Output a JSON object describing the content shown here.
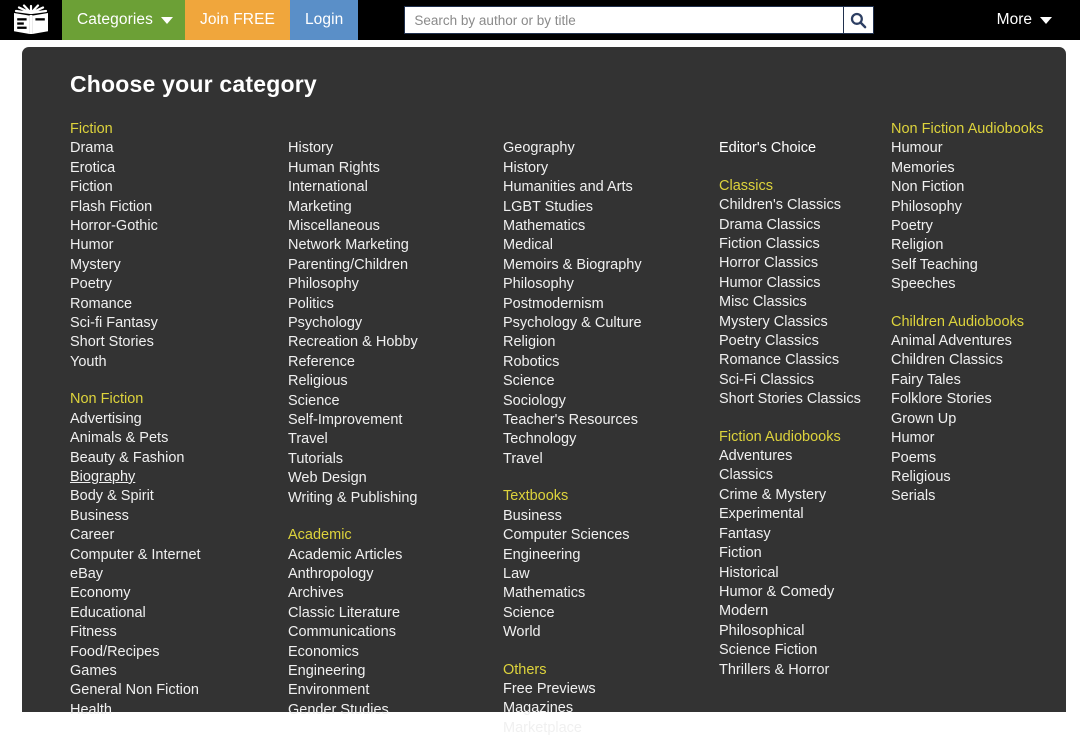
{
  "nav": {
    "logo_icon": "open-book-logo-icon",
    "categories_label": "Categories",
    "categories_caret_icon": "chevron-down-icon",
    "join_label": "Join FREE",
    "login_label": "Login",
    "more_label": "More",
    "more_caret_icon": "chevron-down-icon",
    "colors": {
      "bar": "#000000",
      "categories": "#6ca036",
      "join": "#f0a63c",
      "login": "#5a8fc8"
    }
  },
  "search": {
    "placeholder": "Search by author or by title",
    "value": "",
    "button_icon": "search-icon",
    "icon_color": "#2d3f63"
  },
  "panel": {
    "title": "Choose your category",
    "background": "#333333",
    "heading_color": "#ddd33c",
    "link_color": "#f0f0f0",
    "hovered_item": "Biography",
    "columns": [
      {
        "id": "column-1",
        "groups": [
          {
            "heading": "Fiction",
            "heading_style": "accent",
            "items": [
              "Drama",
              "Erotica",
              "Fiction",
              "Flash Fiction",
              "Horror-Gothic",
              "Humor",
              "Mystery",
              "Poetry",
              "Romance",
              "Sci-fi Fantasy",
              "Short Stories",
              "Youth"
            ]
          },
          {
            "heading": "Non Fiction",
            "heading_style": "accent",
            "items": [
              "Advertising",
              "Animals & Pets",
              "Beauty & Fashion",
              "Biography",
              "Body & Spirit",
              "Business",
              "Career",
              "Computer & Internet",
              "eBay",
              "Economy",
              "Educational",
              "Fitness",
              "Food/Recipes",
              "Games",
              "General Non Fiction",
              "Health"
            ]
          }
        ]
      },
      {
        "id": "column-2",
        "top_offset_rows": 1,
        "groups": [
          {
            "heading": null,
            "items": [
              "History",
              "Human Rights",
              "International",
              "Marketing",
              "Miscellaneous",
              "Network Marketing",
              "Parenting/Children",
              "Philosophy",
              "Politics",
              "Psychology",
              "Recreation & Hobby",
              "Reference",
              "Religious",
              "Science",
              "Self-Improvement",
              "Travel",
              "Tutorials",
              "Web Design",
              "Writing & Publishing"
            ]
          },
          {
            "heading": "Academic",
            "heading_style": "accent",
            "items": [
              "Academic Articles",
              "Anthropology",
              "Archives",
              "Classic Literature",
              "Communications",
              "Economics",
              "Engineering",
              "Environment",
              "Gender Studies"
            ]
          }
        ]
      },
      {
        "id": "column-3",
        "top_offset_rows": 1,
        "groups": [
          {
            "heading": null,
            "items": [
              "Geography",
              "History",
              "Humanities and Arts",
              "LGBT Studies",
              "Mathematics",
              "Medical",
              "Memoirs & Biography",
              "Philosophy",
              "Postmodernism",
              "Psychology & Culture",
              "Religion",
              "Robotics",
              "Science",
              "Sociology",
              "Teacher's Resources",
              "Technology",
              "Travel"
            ]
          },
          {
            "heading": "Textbooks",
            "heading_style": "accent",
            "items": [
              "Business",
              "Computer Sciences",
              "Engineering",
              "Law",
              "Mathematics",
              "Science",
              "World"
            ]
          },
          {
            "heading": "Others",
            "heading_style": "accent",
            "items": [
              "Free Previews",
              "Magazines",
              "Marketplace"
            ]
          }
        ]
      },
      {
        "id": "column-4",
        "top_offset_rows": 1,
        "groups": [
          {
            "heading": "Editor's Choice",
            "heading_style": "plain",
            "items": []
          },
          {
            "heading": "Classics",
            "heading_style": "accent",
            "items": [
              "Children's Classics",
              "Drama Classics",
              "Fiction Classics",
              "Horror Classics",
              "Humor Classics",
              "Misc Classics",
              "Mystery Classics",
              "Poetry Classics",
              "Romance Classics",
              "Sci-Fi Classics",
              "Short Stories Classics"
            ]
          },
          {
            "heading": "Fiction Audiobooks",
            "heading_style": "accent",
            "items": [
              "Adventures",
              "Classics",
              "Crime & Mystery",
              "Experimental",
              "Fantasy",
              "Fiction",
              "Historical",
              "Humor & Comedy",
              "Modern",
              "Philosophical",
              "Science Fiction",
              "Thrillers & Horror"
            ]
          }
        ]
      },
      {
        "id": "column-5",
        "groups": [
          {
            "heading": "Non Fiction Audiobooks",
            "heading_style": "accent",
            "items": [
              "Humour",
              "Memories",
              "Non Fiction",
              "Philosophy",
              "Poetry",
              "Religion",
              "Self Teaching",
              "Speeches"
            ]
          },
          {
            "heading": "Children Audiobooks",
            "heading_style": "accent",
            "items": [
              "Animal Adventures",
              "Children Classics",
              "Fairy Tales",
              "Folklore Stories",
              "Grown Up",
              "Humor",
              "Poems",
              "Religious",
              "Serials"
            ]
          }
        ]
      }
    ]
  }
}
